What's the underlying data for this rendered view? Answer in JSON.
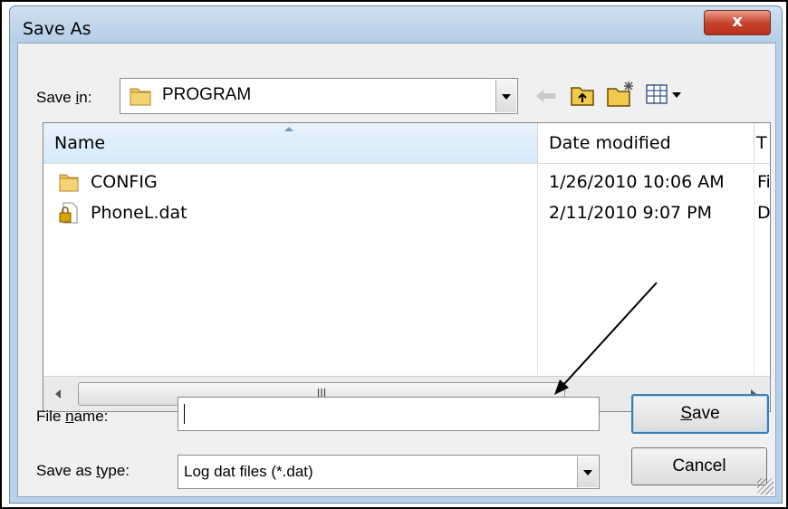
{
  "window": {
    "title": "Save As",
    "close_glyph": "x"
  },
  "toolbar": {
    "save_in_label_pre": "Save ",
    "save_in_label_accel": "i",
    "save_in_label_post": "n:",
    "location_value": "PROGRAM",
    "icons": [
      "back-arrow-icon",
      "up-folder-icon",
      "new-folder-icon",
      "view-menu-icon"
    ]
  },
  "file_list": {
    "columns": [
      "Name",
      "Date modified",
      "T"
    ],
    "rows": [
      {
        "name": "CONFIG",
        "date": "1/26/2010 10:06 AM",
        "type": "Fi",
        "icon": "folder-icon"
      },
      {
        "name": "PhoneL.dat",
        "date": "2/11/2010 9:07 PM",
        "type": "D",
        "icon": "locked-file-icon"
      }
    ],
    "scroll_thumb_glyph": "III"
  },
  "form": {
    "filename_label_pre": "File ",
    "filename_label_accel": "n",
    "filename_label_post": "ame:",
    "filename_value": "",
    "type_label_pre": "Save as ",
    "type_label_accel": "t",
    "type_label_post": "ype:",
    "type_value": "Log dat files (*.dat)"
  },
  "buttons": {
    "save_accel": "S",
    "save_rest": "ave",
    "cancel": "Cancel"
  },
  "colors": {
    "accent": "#3c7fb1",
    "frame": "#b9d1ea",
    "close": "#c8452f"
  }
}
